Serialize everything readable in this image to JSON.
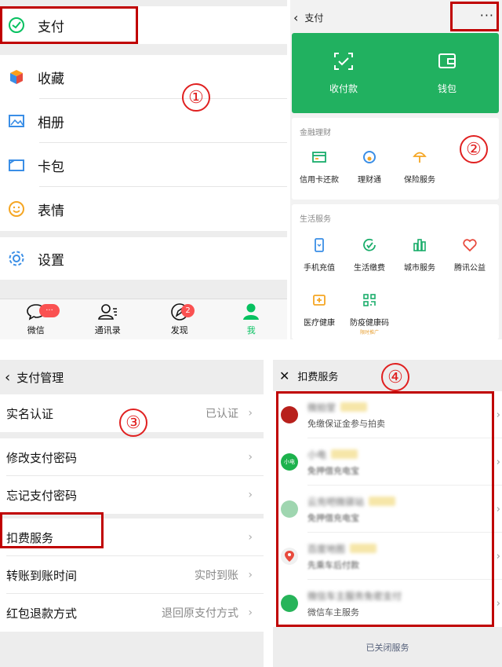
{
  "panel1": {
    "menu": [
      {
        "id": "pay",
        "label": "支付",
        "icon": "wechat-pay-icon"
      },
      {
        "id": "favorites",
        "label": "收藏",
        "icon": "cube-icon"
      },
      {
        "id": "album",
        "label": "相册",
        "icon": "picture-icon"
      },
      {
        "id": "cards",
        "label": "卡包",
        "icon": "card-wallet-icon"
      },
      {
        "id": "stickers",
        "label": "表情",
        "icon": "smiley-icon"
      },
      {
        "id": "settings",
        "label": "设置",
        "icon": "gear-icon"
      }
    ],
    "tabs": [
      {
        "label": "微信",
        "badge": "···",
        "icon": "chat-bubble-icon"
      },
      {
        "label": "通讯录",
        "badge": "",
        "icon": "contacts-icon"
      },
      {
        "label": "发现",
        "badge": "2",
        "icon": "compass-icon"
      },
      {
        "label": "我",
        "badge": "",
        "icon": "person-icon"
      }
    ],
    "annotation": "①"
  },
  "panel2": {
    "header": {
      "back": "‹",
      "title": "支付",
      "more": "···"
    },
    "green_card": [
      {
        "label": "收付款",
        "icon": "scan-pay-icon"
      },
      {
        "label": "钱包",
        "icon": "wallet-icon"
      }
    ],
    "finance": {
      "title": "金融理财",
      "items": [
        {
          "label": "信用卡还款",
          "icon": "credit-card-icon"
        },
        {
          "label": "理财通",
          "icon": "licaitong-icon"
        },
        {
          "label": "保险服务",
          "icon": "umbrella-icon"
        }
      ]
    },
    "life": {
      "title": "生活服务",
      "items": [
        {
          "label": "手机充值",
          "icon": "phone-icon"
        },
        {
          "label": "生活缴费",
          "icon": "bill-check-icon"
        },
        {
          "label": "城市服务",
          "icon": "city-icon"
        },
        {
          "label": "腾讯公益",
          "icon": "heart-icon"
        },
        {
          "label": "医疗健康",
          "icon": "medical-icon"
        },
        {
          "label": "防疫健康码",
          "icon": "qr-code-icon",
          "sub": "限时推广"
        }
      ]
    },
    "annotation": "②"
  },
  "panel3": {
    "header": {
      "back": "‹",
      "title": "支付管理"
    },
    "rows": [
      {
        "label": "实名认证",
        "value": "已认证"
      },
      {
        "label": "修改支付密码",
        "value": ""
      },
      {
        "label": "忘记支付密码",
        "value": ""
      },
      {
        "label": "扣费服务",
        "value": ""
      },
      {
        "label": "转账到账时间",
        "value": "实时到账"
      },
      {
        "label": "红包退款方式",
        "value": "退回原支付方式"
      }
    ],
    "chevron": "›",
    "annotation": "③"
  },
  "panel4": {
    "header": {
      "close": "✕",
      "title": "扣费服务"
    },
    "services": [
      {
        "name": "微拍堂",
        "desc": "免缴保证金参与拍卖",
        "logo_color": "#b8201c",
        "logo_text": ""
      },
      {
        "name": "小电",
        "desc": "免押借充电宝",
        "logo_color": "#1db24d",
        "logo_text": "小电"
      },
      {
        "name": "云充吧微驿站",
        "desc": "免押借充电宝",
        "logo_color": "#9fd6b0",
        "logo_text": ""
      },
      {
        "name": "百度地图",
        "desc": "先乘车后付款",
        "logo_color": "#f0f0f0",
        "logo_text": ""
      },
      {
        "name": "微信车主服务免密支付",
        "desc": "微信车主服务",
        "logo_color": "#27b45a",
        "logo_text": ""
      }
    ],
    "chevron": "›",
    "footer": "已关闭服务",
    "annotation": "④"
  },
  "colors": {
    "wechat_green": "#07c160",
    "card_green": "#21b160",
    "annotation_red": "#c00000",
    "badge_red": "#fa5151"
  }
}
